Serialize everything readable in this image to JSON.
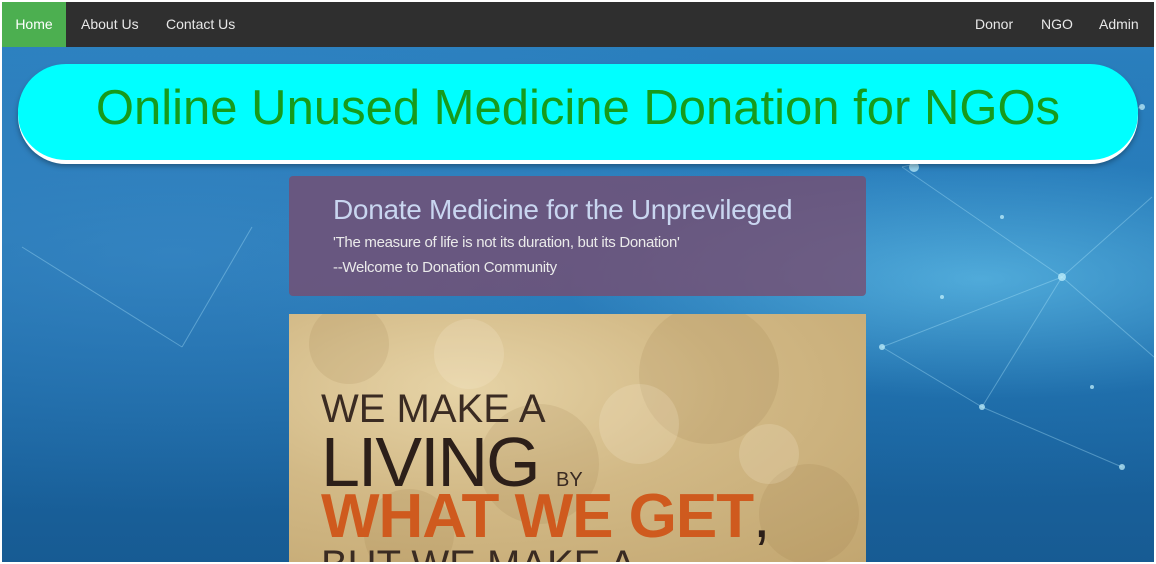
{
  "nav": {
    "left": [
      {
        "label": "Home",
        "active": true
      },
      {
        "label": "About Us",
        "active": false
      },
      {
        "label": "Contact Us",
        "active": false
      }
    ],
    "right": [
      {
        "label": "Donor"
      },
      {
        "label": "NGO"
      },
      {
        "label": "Admin"
      }
    ]
  },
  "banner": {
    "title": "Online Unused Medicine Donation for NGOs"
  },
  "card": {
    "heading": "Donate Medicine for the Unprevileged",
    "quote": "'The measure of life is not its duration, but its Donation'",
    "signature": "--Welcome to Donation Community"
  },
  "poster": {
    "line1": "WE MAKE A",
    "line2": "LIVING",
    "line2_small": "BY",
    "line3": "WHAT WE GET",
    "line3_comma": ",",
    "line4": "BUT WE MAKE A"
  },
  "colors": {
    "nav_bg": "#2f2f2f",
    "nav_active": "#4caf50",
    "banner_bg": "#00ffff",
    "banner_text": "#179b1c",
    "card_bg": "#784b6e",
    "poster_accent": "#cf5a1e"
  }
}
